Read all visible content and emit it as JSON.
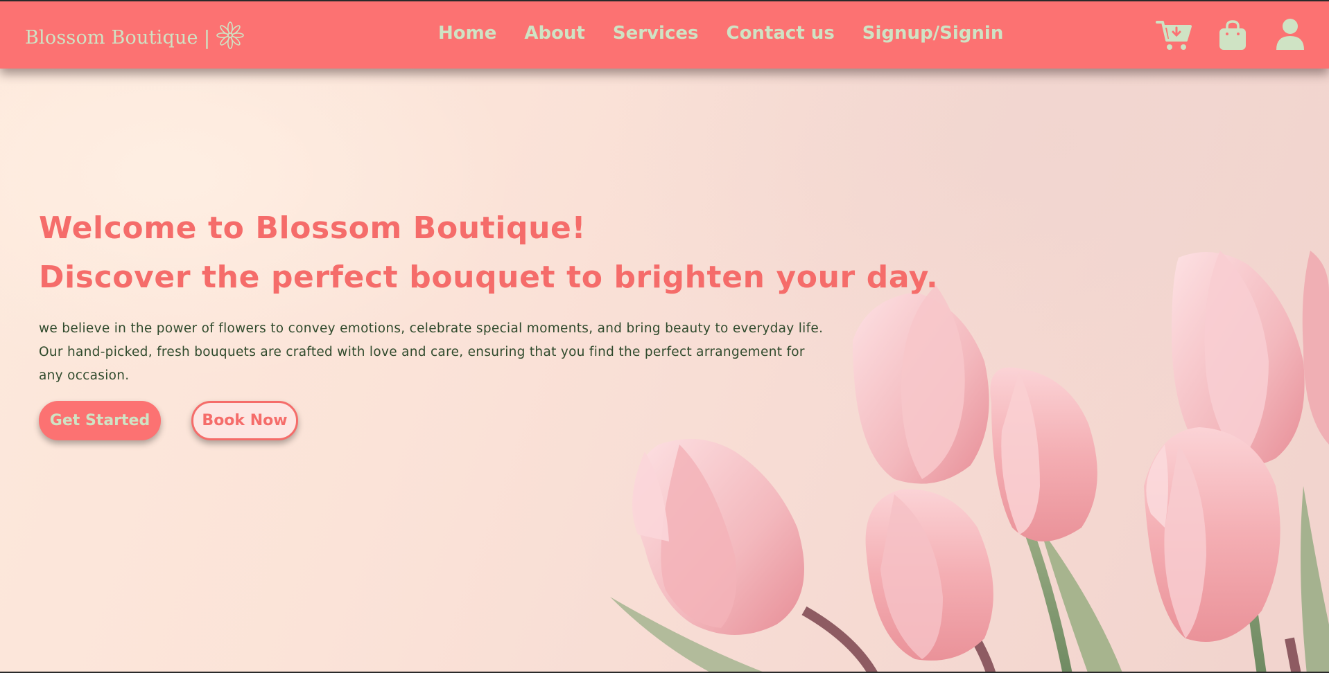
{
  "colors": {
    "navbar_bg": "#fc7272",
    "nav_text": "#cfe3c4",
    "headline": "#f56c6a",
    "body_text": "#2f4a2c",
    "button_primary_bg": "#fc7272",
    "button_secondary_bg": "#fde6e3"
  },
  "header": {
    "brand_name": "Blossom Boutique",
    "brand_separator": "|",
    "brand_icon": "flower-icon",
    "nav": [
      {
        "label": "Home"
      },
      {
        "label": "About"
      },
      {
        "label": "Services"
      },
      {
        "label": "Contact us"
      },
      {
        "label": "Signup/Signin"
      }
    ],
    "icons": [
      "cart-icon",
      "shopping-bag-icon",
      "user-icon"
    ]
  },
  "hero": {
    "title_line1": "Welcome to Blossom Boutique!",
    "title_line2": "Discover the perfect bouquet to brighten your day.",
    "description_line1": "we believe in the power of flowers to convey emotions, celebrate special moments, and bring beauty to everyday life.",
    "description_line2": "Our hand-picked, fresh bouquets are crafted with love and care, ensuring that you find the perfect arrangement for",
    "description_line3": "any occasion.",
    "primary_button": "Get Started",
    "secondary_button": "Book Now",
    "background_image": "pink-tulips-image"
  }
}
